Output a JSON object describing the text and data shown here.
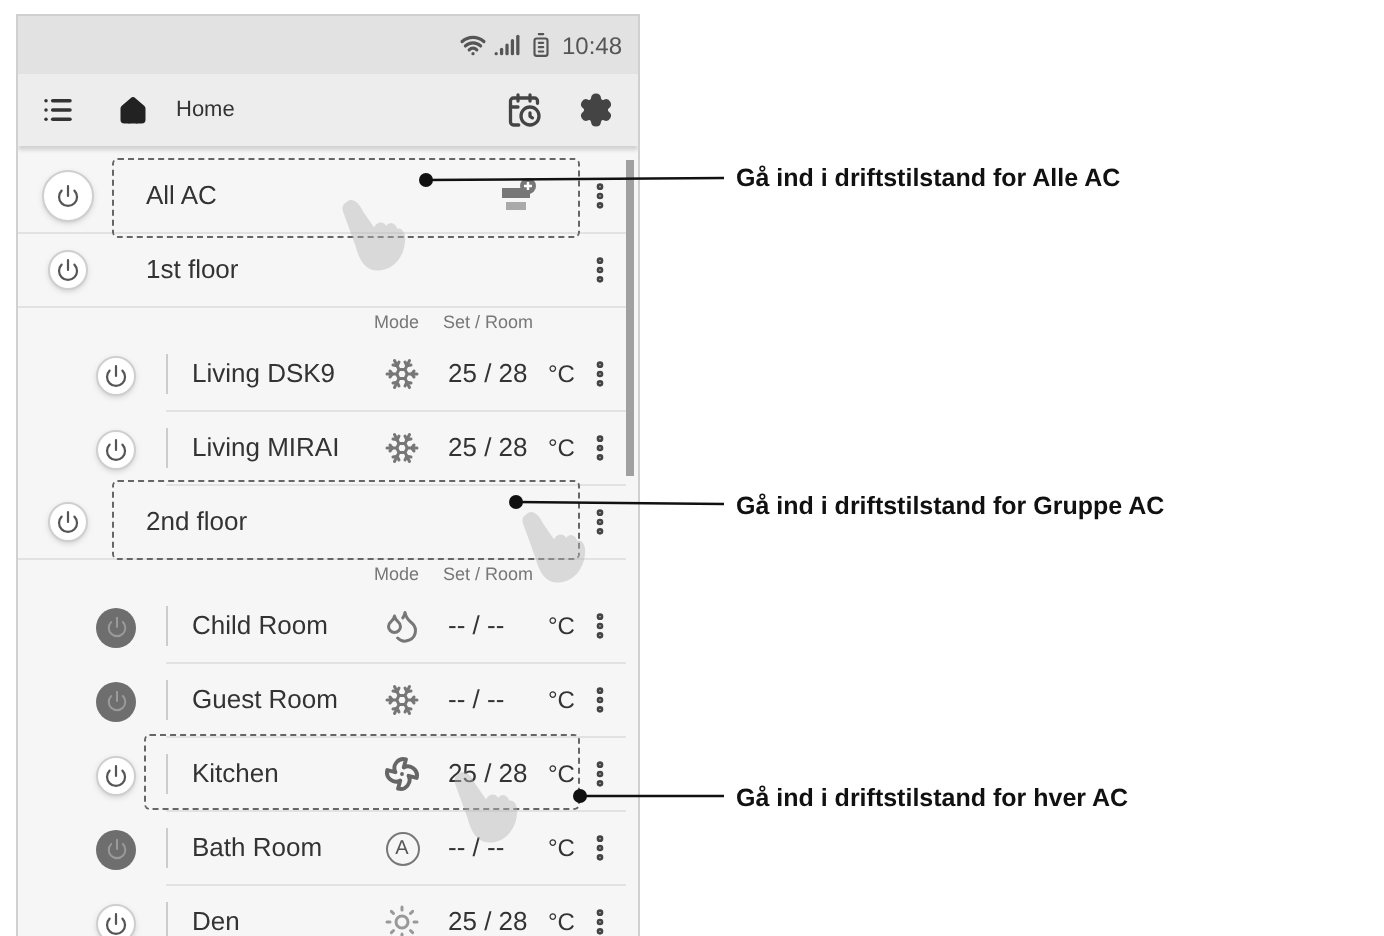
{
  "status_bar": {
    "time": "10:48"
  },
  "header": {
    "title": "Home"
  },
  "rows": [
    {
      "kind": "group",
      "name": "All AC",
      "on": true,
      "all": true
    },
    {
      "kind": "group",
      "name": "1st floor",
      "on": true
    },
    {
      "kind": "labels",
      "mode": "Mode",
      "set_room": "Set / Room"
    },
    {
      "kind": "device",
      "name": "Living DSK9",
      "on": true,
      "mode": {
        "kind": "cool"
      },
      "set_room": "25 / 28",
      "unit": "°C"
    },
    {
      "kind": "device",
      "name": "Living MIRAI",
      "on": true,
      "mode": {
        "kind": "cool"
      },
      "set_room": "25 / 28",
      "unit": "°C"
    },
    {
      "kind": "group",
      "name": "2nd floor",
      "on": true
    },
    {
      "kind": "labels",
      "mode": "Mode",
      "set_room": "Set / Room"
    },
    {
      "kind": "device",
      "name": "Child Room",
      "on": false,
      "mode": {
        "kind": "dry"
      },
      "set_room": "-- / --",
      "unit": "°C"
    },
    {
      "kind": "device",
      "name": "Guest Room",
      "on": false,
      "mode": {
        "kind": "cool"
      },
      "set_room": "-- / --",
      "unit": "°C"
    },
    {
      "kind": "device",
      "name": "Kitchen",
      "on": true,
      "mode": {
        "kind": "fan"
      },
      "set_room": "25 / 28",
      "unit": "°C"
    },
    {
      "kind": "device",
      "name": "Bath Room",
      "on": false,
      "mode": {
        "kind": "auto",
        "symbol": "A"
      },
      "set_room": "-- / --",
      "unit": "°C"
    },
    {
      "kind": "device",
      "name": "Den",
      "on": true,
      "mode": {
        "kind": "heat"
      },
      "set_room": "25 / 28",
      "unit": "°C"
    }
  ],
  "callouts": [
    {
      "text": "Gå ind i driftstilstand for Alle AC"
    },
    {
      "text": "Gå ind i driftstilstand for Gruppe AC"
    },
    {
      "text": "Gå ind i driftstilstand for hver AC"
    }
  ]
}
